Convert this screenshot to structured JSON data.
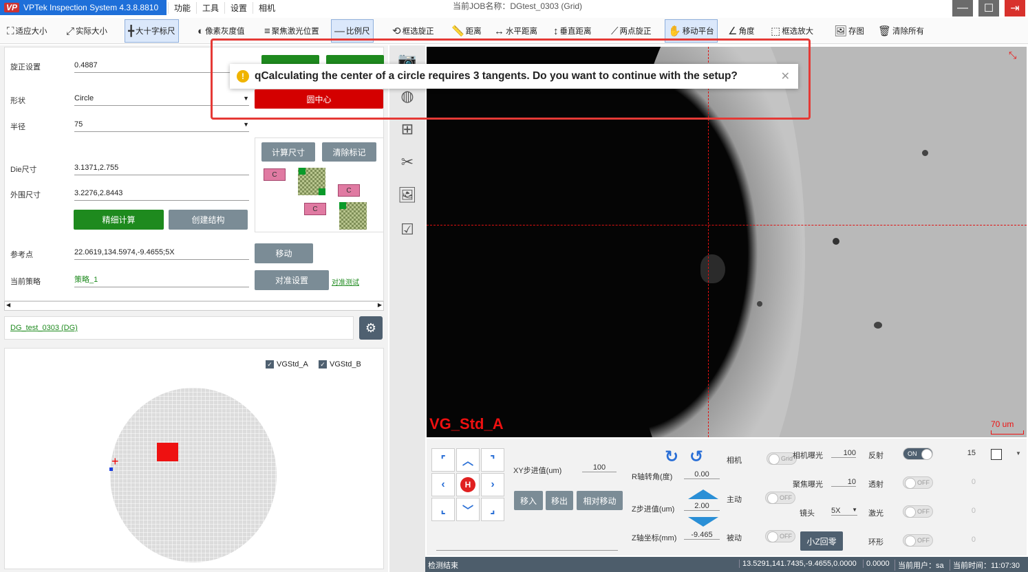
{
  "titlebar": {
    "app_title": "VPTek Inspection System 4.3.8.8810",
    "logo_text": "VP",
    "menu": [
      "功能",
      "工具",
      "设置",
      "相机"
    ],
    "job_label": "当前JOB名称：DGtest_0303 (Grid)"
  },
  "toolbar": {
    "items": [
      {
        "label": "适应大小",
        "icon": "fit-size-icon"
      },
      {
        "label": "实际大小",
        "icon": "actual-size-icon"
      },
      {
        "label": "大十字标尺",
        "icon": "crosshair-icon"
      },
      {
        "label": "像素灰度值",
        "icon": "grayscale-icon"
      },
      {
        "label": "聚焦激光位置",
        "icon": "laser-focus-icon"
      },
      {
        "label": "比例尺",
        "icon": "scale-bar-icon"
      },
      {
        "label": "框选旋正",
        "icon": "rotate-select-icon"
      },
      {
        "label": "距离",
        "icon": "ruler-icon"
      },
      {
        "label": "水平距离",
        "icon": "horizontal-distance-icon"
      },
      {
        "label": "垂直距离",
        "icon": "vertical-distance-icon"
      },
      {
        "label": "两点旋正",
        "icon": "two-point-rotate-icon"
      },
      {
        "label": "移动平台",
        "icon": "hand-move-icon"
      },
      {
        "label": "角度",
        "icon": "angle-icon"
      },
      {
        "label": "框选放大",
        "icon": "zoom-select-icon"
      },
      {
        "label": "存图",
        "icon": "save-image-icon"
      },
      {
        "label": "清除所有",
        "icon": "trash-icon"
      }
    ]
  },
  "left_panel": {
    "fields": [
      {
        "label": "旋正设置",
        "value": "0.4887"
      },
      {
        "label": "形状",
        "value": "Circle"
      },
      {
        "label": "半径",
        "value": "75"
      },
      {
        "label": "Die尺寸",
        "value": "3.1371,2.755"
      },
      {
        "label": "外围尺寸",
        "value": "3.2276,2.8443"
      },
      {
        "label": "参考点",
        "value": "22.0619,134.5974,-9.4655;5X"
      },
      {
        "label": "当前策略",
        "value": "策略_1"
      }
    ],
    "btn_center": "圆中心",
    "btn_calc_size": "计算尺寸",
    "btn_clear_mark": "清除标记",
    "btn_fine_calc": "精细计算",
    "btn_create_struct": "创建结构",
    "btn_move": "移动",
    "btn_align": "对准设置",
    "link_align_test": "对准测试",
    "chip_label": "C",
    "job_link": "DG_test_0303 (DG)",
    "legend_a": "VGStd_A",
    "legend_b": "VGStd_B"
  },
  "dialog": {
    "message": "qCalculating the center of a circle requires 3 tangents. Do you want to continue with the setup?"
  },
  "camera": {
    "overlay_label": "VG_Std_A",
    "scale_label": "70 um"
  },
  "controls": {
    "xy_step_label": "XY步进值(um)",
    "xy_step_value": "100",
    "btn_move_in": "移入",
    "btn_move_out": "移出",
    "btn_relative": "相对移动",
    "r_axis_label": "R轴转角(度)",
    "r_axis_value": "0.00",
    "z_step_label": "Z步进值(um)",
    "z_step_value": "2.00",
    "z_coord_label": "Z轴坐标(mm)",
    "z_coord_value": "-9.465",
    "camera_label": "相机",
    "camera_toggle": "Grid",
    "camera_exposure_label": "相机曝光",
    "camera_exposure_value": "100",
    "active_label": "主动",
    "focus_exposure_label": "聚焦曝光",
    "focus_exposure_value": "10",
    "lens_label": "镜头",
    "lens_value": "5X",
    "passive_label": "被动",
    "btn_small_z_home": "小Z回零",
    "reflect_label": "反射",
    "reflect_value": "15",
    "transmit_label": "透射",
    "transmit_value": "0",
    "laser_label": "激光",
    "laser_value": "0",
    "ring_label": "环形",
    "ring_value": "0",
    "on_text": "ON",
    "off_text": "OFF",
    "home_text": "H"
  },
  "statusbar": {
    "status": "检测结束",
    "coords": "13.5291,141.7435,-9.4655,0.0000",
    "value2": "0.0000",
    "user": "当前用户：sa",
    "time": "当前时间：11:07:30"
  }
}
